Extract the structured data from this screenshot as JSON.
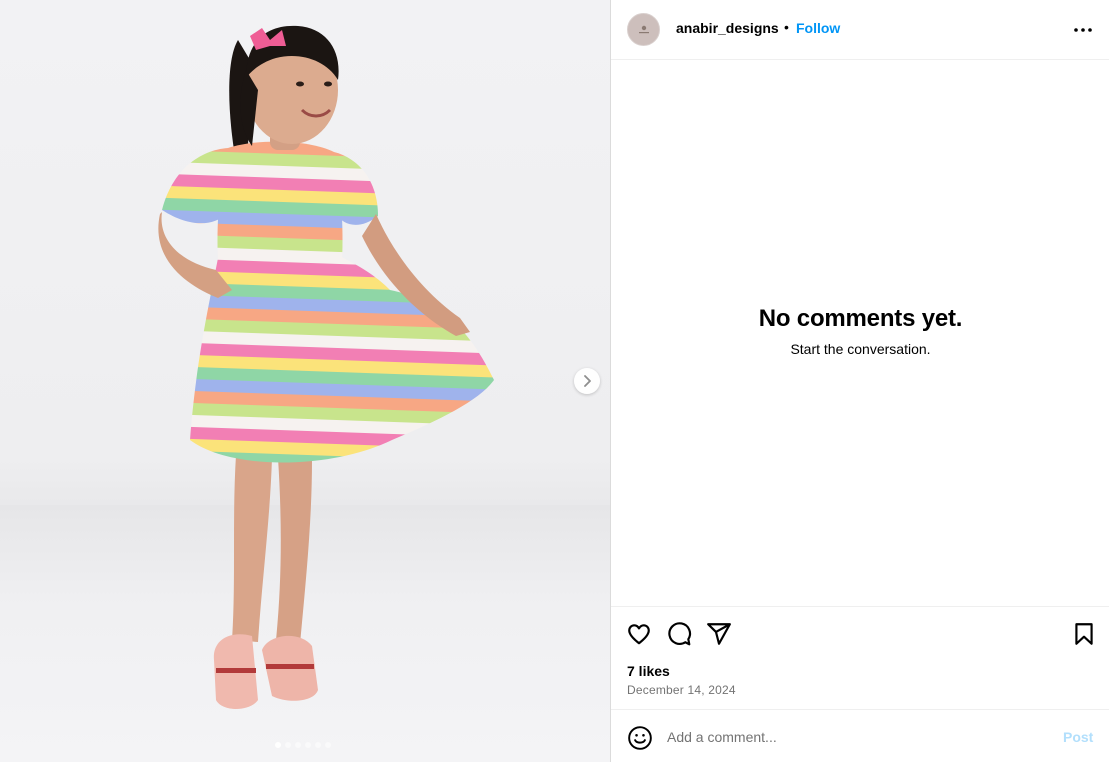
{
  "post": {
    "username": "anabir_designs",
    "separator": "•",
    "follow_label": "Follow",
    "likes_text": "7 likes",
    "date": "December 14, 2024"
  },
  "comments": {
    "empty_title": "No comments yet.",
    "empty_subtitle": "Start the conversation."
  },
  "comment_box": {
    "placeholder": "Add a comment...",
    "post_label": "Post"
  },
  "media": {
    "slide_count": 6,
    "active_slide": 1
  },
  "icons": {
    "more": "more-options-icon",
    "like": "heart-icon",
    "comment": "comment-icon",
    "share": "paper-plane-icon",
    "save": "bookmark-icon",
    "emoji": "emoji-icon",
    "next": "chevron-right-icon"
  },
  "colors": {
    "accent": "#0095f6",
    "post_disabled": "#b2dffc",
    "muted_text": "#737373",
    "border": "#dbdbdb"
  }
}
